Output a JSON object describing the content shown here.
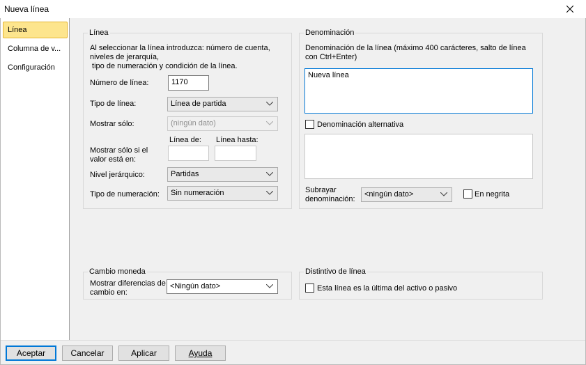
{
  "window": {
    "title": "Nueva línea"
  },
  "sidebar": {
    "items": [
      {
        "label": "Línea",
        "active": true
      },
      {
        "label": "Columna de v..."
      },
      {
        "label": "Configuración"
      }
    ]
  },
  "linea": {
    "legend": "Línea",
    "intro_1": "Al seleccionar la línea introduzca: número de cuenta,",
    "intro_2": "niveles de jerarquía,",
    "intro_3": " tipo de numeración y condición de la línea.",
    "numero_label": "Número de línea:",
    "numero_value": "1170",
    "tipo_label": "Tipo de línea:",
    "tipo_value": "Línea de partida",
    "mostrar_label": "Mostrar sólo:",
    "mostrar_value": "(ningún dato)",
    "linea_de_label": "Línea de:",
    "linea_hasta_label": "Línea hasta:",
    "mostrar_si_1": "Mostrar sólo si el",
    "mostrar_si_2": "valor está en:",
    "nivel_label": "Nivel jerárquico:",
    "nivel_value": "Partidas",
    "numeracion_label": "Tipo de numeración:",
    "numeracion_value": "Sin numeración"
  },
  "denominacion": {
    "legend": "Denominación",
    "hint_1": "Denominación de la línea (máximo 400 carácteres, salto de línea",
    "hint_2": "con Ctrl+Enter)",
    "text_value": "Nueva línea",
    "alt_label": "Denominación alternativa",
    "subrayar_1": "Subrayar",
    "subrayar_2": "denominación:",
    "subrayar_value": "<ningún dato>",
    "negrita_label": "En negrita"
  },
  "cambio": {
    "legend": "Cambio moneda",
    "label_1": "Mostrar diferencias de",
    "label_2": "cambio en:",
    "value": "<Ningún dato>"
  },
  "distintivo": {
    "legend": "Distintivo de línea",
    "check_label": "Esta línea es la última del activo o pasivo"
  },
  "buttons": {
    "accept": "Aceptar",
    "cancel": "Cancelar",
    "apply": "Aplicar",
    "help": "Ayuda"
  },
  "colors": {
    "accent": "#0078d7",
    "selected_item": "#fde58d"
  },
  "icons": {
    "close": "close-icon",
    "dropdown": "chevron-down-icon"
  }
}
